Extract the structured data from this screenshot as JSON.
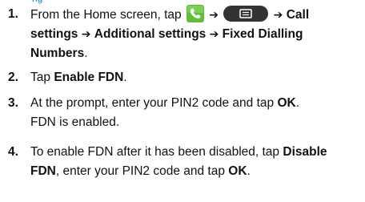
{
  "header_fragment": "ng",
  "steps": [
    {
      "number": "1.",
      "text_prefix": "From the Home screen, tap",
      "arrow": "➔",
      "call_settings": "Call",
      "call_settings_2": "settings",
      "additional_settings": "Additional settings",
      "fdn_menu": "Fixed Dialling",
      "fdn_menu_2": "Numbers",
      "period": "."
    },
    {
      "number": "2.",
      "text_prefix": "Tap",
      "target": "Enable FDN",
      "period": "."
    },
    {
      "number": "3.",
      "text_prefix": "At the prompt, enter your PIN2 code and tap",
      "target": "OK",
      "period": ".",
      "result": "FDN is enabled."
    },
    {
      "number": "4.",
      "text_prefix": "To enable FDN after it has been disabled, tap",
      "target_1": "Disable",
      "target_1b": "FDN",
      "text_mid": ", enter your PIN2 code and tap",
      "target_2": "OK",
      "period": "."
    }
  ],
  "colors": {
    "accent": "#1a86c8",
    "phone_icon_bg": "#5fbf3a",
    "menu_key_bg": "#333333"
  },
  "icons": {
    "phone": "phone-app-icon",
    "menu": "menu-key-icon"
  }
}
